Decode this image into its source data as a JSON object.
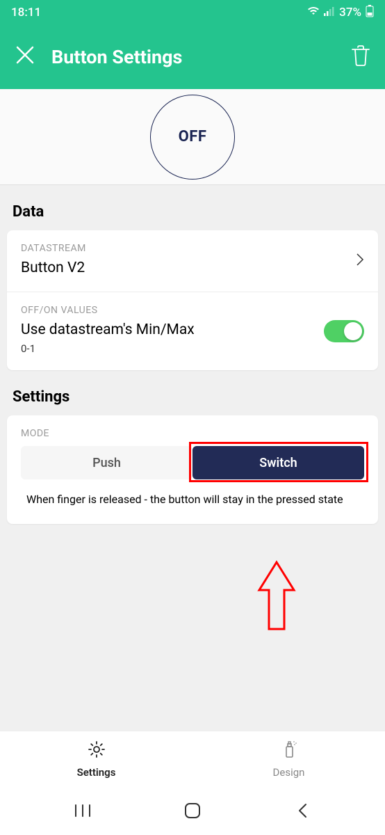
{
  "status": {
    "time": "18:11",
    "battery": "37%"
  },
  "header": {
    "title": "Button Settings"
  },
  "preview": {
    "state": "OFF"
  },
  "sections": {
    "data": {
      "label": "Data",
      "datastream": {
        "label": "DATASTREAM",
        "value": "Button V2"
      },
      "offon": {
        "label": "OFF/ON VALUES",
        "value": "Use datastream's Min/Max",
        "range": "0-1",
        "toggle": true
      }
    },
    "settings": {
      "label": "Settings",
      "mode": {
        "label": "MODE",
        "options": {
          "push": "Push",
          "switch": "Switch"
        },
        "selected": "switch",
        "description": "When finger is released - the button will stay in the pressed state"
      }
    }
  },
  "tabs": {
    "settings": "Settings",
    "design": "Design"
  }
}
